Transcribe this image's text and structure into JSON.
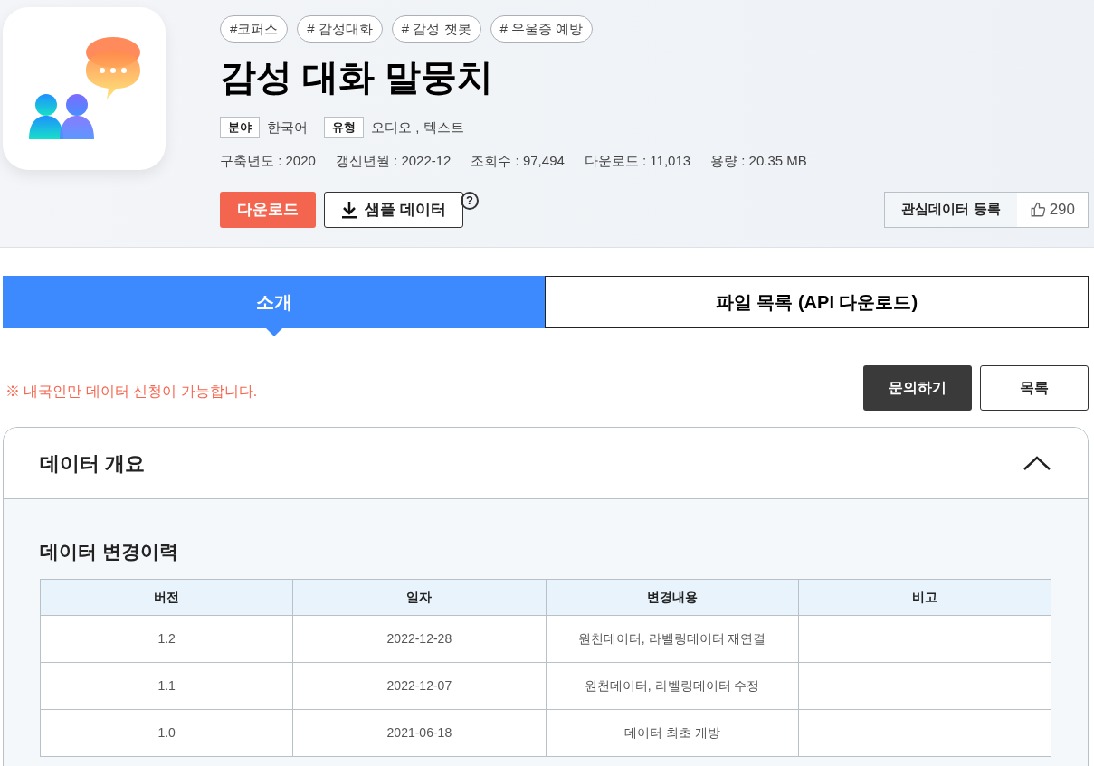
{
  "tags": [
    "#코퍼스",
    "# 감성대화",
    "# 감성 챗봇",
    "# 우울증 예방"
  ],
  "title": "감성 대화 말뭉치",
  "attributes": [
    {
      "label": "분야",
      "value": "한국어"
    },
    {
      "label": "유형",
      "value": "오디오 , 텍스트"
    }
  ],
  "meta": [
    "구축년도 : 2020",
    "갱신년월 : 2022-12",
    "조회수 : 97,494",
    "다운로드 : 11,013",
    "용량 : 20.35 MB"
  ],
  "buttons": {
    "download": "다운로드",
    "sample": "샘플 데이터",
    "help": "?"
  },
  "interest": {
    "label": "관심데이터 등록",
    "count": "290"
  },
  "tabs": [
    {
      "label": "소개",
      "selected": true
    },
    {
      "label": "파일 목록 (API 다운로드)",
      "selected": false
    }
  ],
  "notice": "※ 내국인만 데이터 신청이 가능합니다.",
  "actions": [
    "문의하기",
    "목록"
  ],
  "section": {
    "title": "데이터 개요",
    "expanded": true,
    "subtitle": "데이터 변경이력",
    "table": {
      "columns": [
        "버전",
        "일자",
        "변경내용",
        "비고"
      ],
      "rows": [
        [
          "1.2",
          "2022-12-28",
          "원천데이터, 라벨링데이터 재연결",
          ""
        ],
        [
          "1.1",
          "2022-12-07",
          "원천데이터, 라벨링데이터 수정",
          ""
        ],
        [
          "1.0",
          "2021-06-18",
          "데이터 최초 개방",
          ""
        ]
      ]
    }
  }
}
